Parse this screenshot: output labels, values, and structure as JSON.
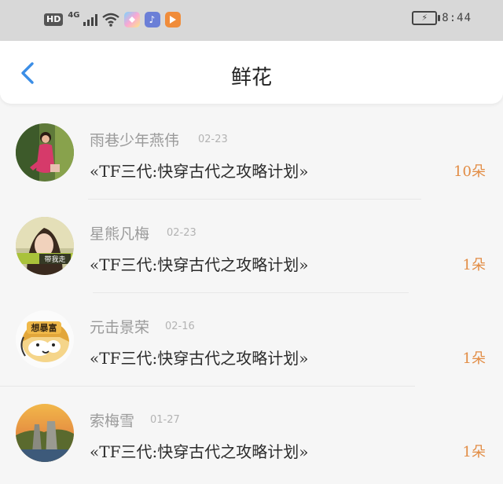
{
  "status_bar": {
    "network_badge": "HD",
    "network_type": "4G",
    "time": "8:44"
  },
  "header": {
    "title": "鲜花"
  },
  "items": [
    {
      "name": "雨巷少年燕伟",
      "date": "02-23",
      "book": "«TF三代:快穿古代之攻略计划»",
      "count": "10朵"
    },
    {
      "name": "星熊凡梅",
      "date": "02-23",
      "book": "«TF三代:快穿古代之攻略计划»",
      "count": "1朵"
    },
    {
      "name": "元击景荣",
      "date": "02-16",
      "book": "«TF三代:快穿古代之攻略计划»",
      "count": "1朵"
    },
    {
      "name": "索梅雪",
      "date": "01-27",
      "book": "«TF三代:快穿古代之攻略计划»",
      "count": "1朵"
    }
  ],
  "avatar_texts": [
    "带我走",
    "想暴富"
  ],
  "colors": {
    "accent_blue": "#3b8ee6",
    "count_orange": "#e28c44"
  }
}
